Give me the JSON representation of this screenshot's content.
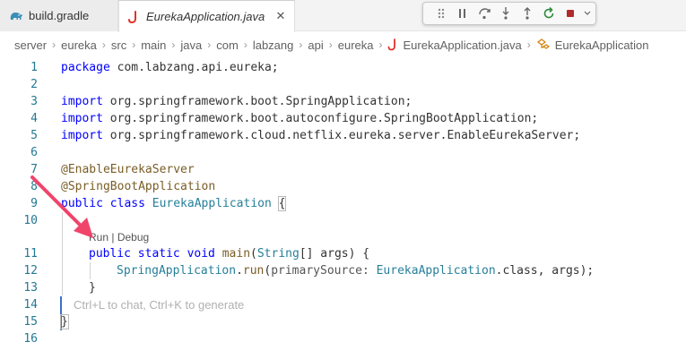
{
  "tabs": [
    {
      "label": "build.gradle",
      "icon": "gradle-elephant-icon",
      "active": false
    },
    {
      "label": "EurekaApplication.java",
      "icon": "java-icon",
      "active": true,
      "close": "✕"
    }
  ],
  "debug_toolbar": {
    "buttons": [
      "drag-handle",
      "pause",
      "step-over",
      "step-into",
      "step-out",
      "restart",
      "stop",
      "more-options"
    ]
  },
  "breadcrumb": {
    "items": [
      "server",
      "eureka",
      "src",
      "main",
      "java",
      "com",
      "labzang",
      "api",
      "eureka",
      "EurekaApplication.java",
      "EurekaApplication"
    ],
    "separator": "›"
  },
  "codelens": {
    "run": "Run",
    "divider": "|",
    "debug": "Debug"
  },
  "placeholder": "Ctrl+L to chat, Ctrl+K to generate",
  "line_numbers": [
    "1",
    "2",
    "3",
    "4",
    "5",
    "6",
    "7",
    "8",
    "9",
    "10",
    "11",
    "12",
    "13",
    "14",
    "15",
    "16"
  ],
  "code": {
    "l1_kw": "package",
    "l1_rest": " com.labzang.api.eureka;",
    "l3_kw": "import",
    "l3_rest": " org.springframework.boot.SpringApplication;",
    "l4_kw": "import",
    "l4_rest": " org.springframework.boot.autoconfigure.SpringBootApplication;",
    "l5_kw": "import",
    "l5_rest": " org.springframework.cloud.netflix.eureka.server.EnableEurekaServer;",
    "l7": "@EnableEurekaServer",
    "l8": "@SpringBootApplication",
    "l9_kw": "public class",
    "l9_name": " EurekaApplication ",
    "l9_brace": "{",
    "l11_kw": "public static void",
    "l11_fn": " main",
    "l11_open": "(",
    "l11_type": "String",
    "l11_rest": "[] args) {",
    "l12_type": "SpringApplication",
    "l12_dot": ".",
    "l12_fn": "run",
    "l12_open": "(",
    "l12_hint": "primarySource:",
    "l12_type2": " EurekaApplication",
    "l12_rest": ".class, args);",
    "l13": "}",
    "l15": "}"
  },
  "colors": {
    "accent": "#3f6fc8",
    "arrow": "#f0446b",
    "keyword": "#0000ff",
    "type": "#267f99",
    "annotation": "#795e26",
    "line_number": "#237893"
  }
}
